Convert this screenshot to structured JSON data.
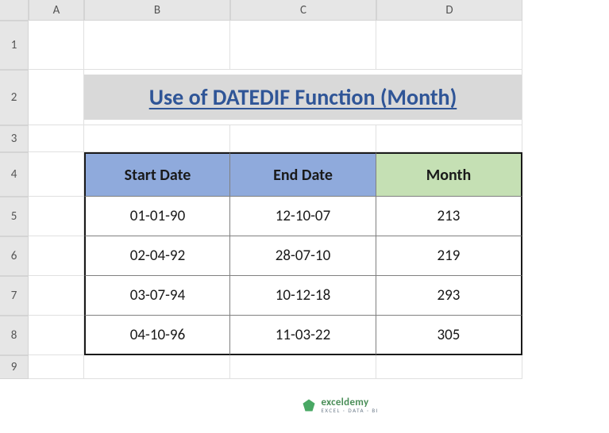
{
  "columns": [
    "A",
    "B",
    "C",
    "D"
  ],
  "rows": [
    "1",
    "2",
    "3",
    "4",
    "5",
    "6",
    "7",
    "8",
    "9"
  ],
  "title": "Use of DATEDIF Function (Month)",
  "headers": {
    "start": "Start Date",
    "end": "End Date",
    "month": "Month"
  },
  "data": [
    {
      "start": "01-01-90",
      "end": "12-10-07",
      "month": "213"
    },
    {
      "start": "02-04-92",
      "end": "28-07-10",
      "month": "219"
    },
    {
      "start": "03-07-94",
      "end": "10-12-18",
      "month": "293"
    },
    {
      "start": "04-10-96",
      "end": "11-03-22",
      "month": "305"
    }
  ],
  "watermark": {
    "name": "exceldemy",
    "tagline": "EXCEL · DATA · BI"
  },
  "chart_data": {
    "type": "table",
    "title": "Use of DATEDIF Function (Month)",
    "columns": [
      "Start Date",
      "End Date",
      "Month"
    ],
    "rows": [
      [
        "01-01-90",
        "12-10-07",
        213
      ],
      [
        "02-04-92",
        "28-07-10",
        219
      ],
      [
        "03-07-94",
        "10-12-18",
        293
      ],
      [
        "04-10-96",
        "11-03-22",
        305
      ]
    ]
  }
}
